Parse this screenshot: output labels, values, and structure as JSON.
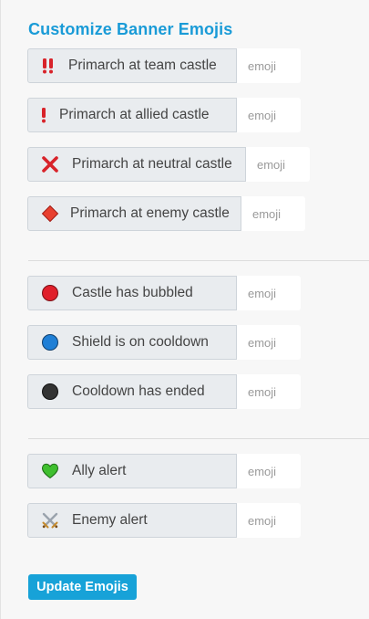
{
  "title": "Customize Banner Emojis",
  "groups": [
    {
      "items": [
        {
          "label": "Primarch at team castle",
          "icon": "double-exclamation-icon",
          "placeholder": "emoji"
        },
        {
          "label": "Primarch at allied castle",
          "icon": "exclamation-icon",
          "placeholder": "emoji"
        },
        {
          "label": "Primarch at neutral castle",
          "icon": "cross-mark-icon",
          "placeholder": "emoji"
        },
        {
          "label": "Primarch at enemy castle",
          "icon": "red-diamond-icon",
          "placeholder": "emoji"
        }
      ]
    },
    {
      "items": [
        {
          "label": "Castle has bubbled",
          "icon": "red-circle-icon",
          "placeholder": "emoji"
        },
        {
          "label": "Shield is on cooldown",
          "icon": "blue-circle-icon",
          "placeholder": "emoji"
        },
        {
          "label": "Cooldown has ended",
          "icon": "black-circle-icon",
          "placeholder": "emoji"
        }
      ]
    },
    {
      "items": [
        {
          "label": "Ally alert",
          "icon": "green-heart-icon",
          "placeholder": "emoji"
        },
        {
          "label": "Enemy alert",
          "icon": "crossed-swords-icon",
          "placeholder": "emoji"
        }
      ]
    }
  ],
  "button_label": "Update Emojis",
  "colors": {
    "accent": "#1a9bd7",
    "button": "#17a2d8",
    "red": "#e0202b",
    "blue": "#1f7fd6",
    "green": "#3fbf2f"
  }
}
